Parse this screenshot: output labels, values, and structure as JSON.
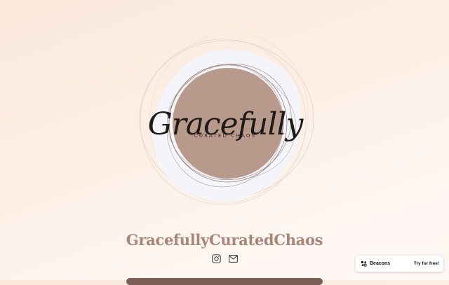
{
  "profile": {
    "name": "GracefullyCuratedChaos",
    "logo": {
      "script_text": "Gracefully",
      "subtitle": "CURATED CHAOS",
      "colors": {
        "disc": "#f4f5fb",
        "circle": "#b89a8c",
        "ink": "#1e1a18"
      }
    }
  },
  "social_links": [
    {
      "icon": "instagram-icon",
      "label": "Instagram"
    },
    {
      "icon": "mail-icon",
      "label": "Email"
    }
  ],
  "badge": {
    "brand": "Beacons",
    "cta": "Try for free!",
    "icon": "beacons-logo-icon"
  },
  "colors": {
    "name_text": "#a88677",
    "link_bar": "#7d5e55",
    "background_top": "#fbe9db",
    "background_bottom": "#fdf7f3"
  }
}
